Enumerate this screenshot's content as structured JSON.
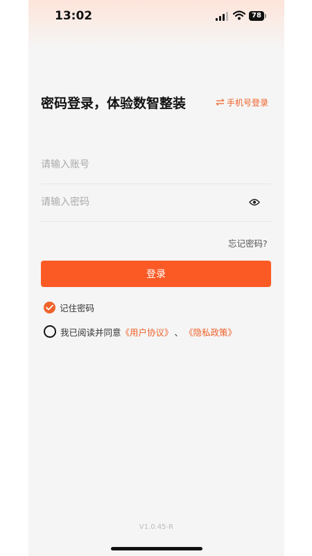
{
  "status_bar": {
    "time": "13:02",
    "battery": "78",
    "icons": [
      "signal-icon",
      "wifi-icon",
      "battery-icon"
    ]
  },
  "header": {
    "title": "密码登录，体验数智整装",
    "switch_login_label": "手机号登录",
    "switch_icon": "swap-arrows-icon"
  },
  "form": {
    "account_placeholder": "请输入账号",
    "account_value": "",
    "password_placeholder": "请输入密码",
    "password_value": "",
    "password_toggle_icon": "eye-icon",
    "forgot_label": "忘记密码?",
    "login_label": "登录"
  },
  "options": {
    "remember_label": "记住密码",
    "remember_checked": true,
    "agree_prefix": "我已阅读并同意",
    "user_agreement": "《用户协议》",
    "separator": "、",
    "privacy_policy": "《隐私政策》",
    "agree_checked": false
  },
  "footer": {
    "version": "V1.0.45-R"
  },
  "colors": {
    "accent": "#fb5a25",
    "link": "#f0622a",
    "background": "#f5f5f5"
  }
}
